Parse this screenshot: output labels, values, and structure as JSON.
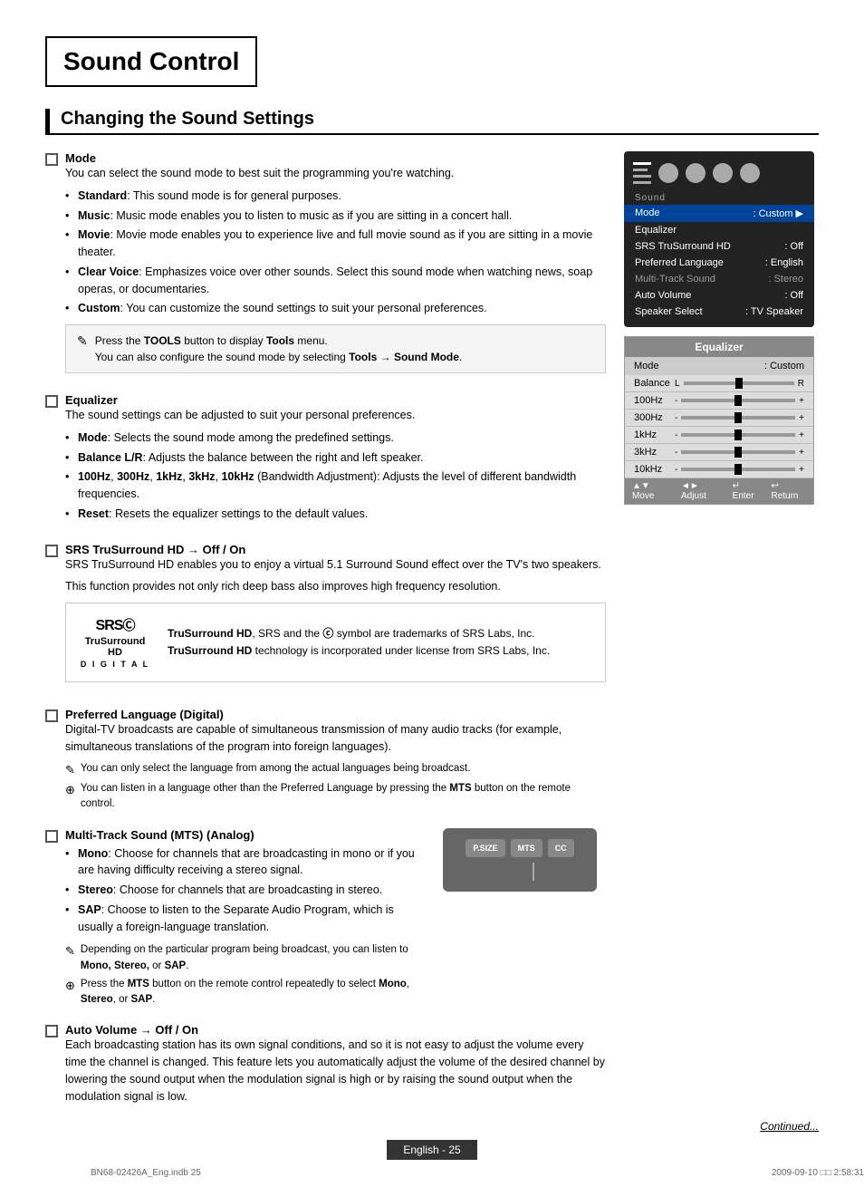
{
  "page": {
    "title": "Sound Control",
    "section_title": "Changing the Sound Settings"
  },
  "mode_section": {
    "title": "Mode",
    "intro": "You can select the sound mode to best suit the programming you're watching.",
    "bullets": [
      {
        "label": "Standard",
        "text": ": This sound mode is for general purposes."
      },
      {
        "label": "Music",
        "text": ": Music mode enables you to listen to music as if you are sitting in a concert hall."
      },
      {
        "label": "Movie",
        "text": ": Movie mode enables you to experience live and full movie sound as if you are sitting in a movie theater."
      },
      {
        "label": "Clear Voice",
        "text": ": Emphasizes voice over other sounds. Select this sound mode when watching news, soap operas, or documentaries."
      },
      {
        "label": "Custom",
        "text": ": You can customize the sound settings to suit your personal preferences."
      }
    ],
    "note": {
      "icon": "✎",
      "lines": [
        "Press the TOOLS button to display Tools menu.",
        "You can also configure the sound mode by selecting Tools → Sound Mode."
      ]
    }
  },
  "equalizer_section": {
    "title": "Equalizer",
    "intro": "The sound settings can be adjusted to suit your personal preferences.",
    "bullets": [
      {
        "label": "Mode",
        "text": ": Selects the sound mode among the predefined settings."
      },
      {
        "label": "Balance L/R",
        "text": ": Adjusts the balance between the right and left speaker."
      },
      {
        "label": "100Hz",
        "text": ", 300Hz, 1kHz, 3kHz, 10kHz (Bandwidth Adjustment): Adjusts the level of different bandwidth frequencies."
      },
      {
        "label": "Reset",
        "text": ": Resets the equalizer settings to the default values."
      }
    ]
  },
  "srs_section": {
    "title": "SRS TruSurround HD → Off / On",
    "intro": "SRS TruSurround HD enables you to enjoy a virtual 5.1 Surround Sound effect over the TV's two speakers.",
    "intro2": "This function provides not only rich deep bass also improves high frequency resolution.",
    "srs_note1": "TruSurround HD, SRS and the ⓒ symbol are trademarks of SRS Labs, Inc.",
    "srs_note2": "TruSurround HD technology is incorporated under license from SRS Labs, Inc.",
    "srs_logo_line1": "SRS(",
    "srs_logo_line2": "TruSurround HD",
    "srs_logo_line3": "D I G I T A L"
  },
  "preferred_lang_section": {
    "title": "Preferred Language (Digital)",
    "intro": "Digital-TV broadcasts are capable of simultaneous transmission of many audio tracks (for example, simultaneous translations of the program into foreign languages).",
    "notes": [
      {
        "icon": "✎",
        "text": "You can only select the language from among the actual languages being broadcast."
      },
      {
        "icon": "⊕",
        "text": "You can listen in a language other than the Preferred Language by pressing the MTS button on the remote control."
      }
    ]
  },
  "multitrack_section": {
    "title": "Multi-Track Sound (MTS) (Analog)",
    "intro": "",
    "bullets": [
      {
        "label": "Mono",
        "text": ": Choose for channels that are broadcasting in mono or if you are having difficulty receiving a stereo signal."
      },
      {
        "label": "Stereo",
        "text": ": Choose for channels that are broadcasting in stereo."
      },
      {
        "label": "SAP",
        "text": ": Choose to listen to the Separate Audio Program, which is usually a foreign-language translation."
      }
    ],
    "notes": [
      {
        "icon": "✎",
        "text": "Depending on the particular program being broadcast, you can listen to Mono, Stereo, or SAP."
      },
      {
        "icon": "⊕",
        "text": "Press the MTS button on the remote control repeatedly to select Mono, Stereo, or SAP."
      }
    ]
  },
  "auto_volume_section": {
    "title": "Auto Volume → Off / On",
    "intro": "Each broadcasting station has its own signal conditions, and so it is not easy to adjust the volume every time the channel is changed. This feature lets you automatically adjust the volume of the desired channel by lowering the sound output when the modulation signal is high or by raising the sound output when the modulation signal is low."
  },
  "tv_menu": {
    "title": "Sound",
    "rows": [
      {
        "label": "Mode",
        "value": ": Custom",
        "highlighted": true
      },
      {
        "label": "Equalizer",
        "value": "",
        "highlighted": false
      },
      {
        "label": "SRS TruSurround HD",
        "value": ": Off",
        "highlighted": false
      },
      {
        "label": "Preferred Language",
        "value": ": English",
        "highlighted": false
      },
      {
        "label": "Multi-Track Sound",
        "value": ": Stereo",
        "highlighted": false,
        "dimmed": true
      },
      {
        "label": "Auto Volume",
        "value": ": Off",
        "highlighted": false
      },
      {
        "label": "Speaker Select",
        "value": ": TV Speaker",
        "highlighted": false
      }
    ]
  },
  "eq_menu": {
    "title": "Equalizer",
    "mode_label": "Mode",
    "mode_value": ": Custom",
    "rows": [
      {
        "label": "Balance",
        "minus": "L",
        "plus": "R",
        "pos": 50
      },
      {
        "label": "100Hz",
        "minus": "-",
        "plus": "+",
        "pos": 50
      },
      {
        "label": "300Hz",
        "minus": "-",
        "plus": "+",
        "pos": 50
      },
      {
        "label": "1kHz",
        "minus": "-",
        "plus": "+",
        "pos": 50
      },
      {
        "label": "3kHz",
        "minus": "-",
        "plus": "+",
        "pos": 50
      },
      {
        "label": "10kHz",
        "minus": "-",
        "plus": "+",
        "pos": 50
      }
    ],
    "footer": "▲▼ Move  ◄► Adjust  ↵ Enter  ↩ Return"
  },
  "footer": {
    "continued": "Continued...",
    "page_label": "English - 25",
    "doc_left": "BN68-02426A_Eng.indb   25",
    "doc_right": "2009-09-10   □□ 2:58:31"
  }
}
